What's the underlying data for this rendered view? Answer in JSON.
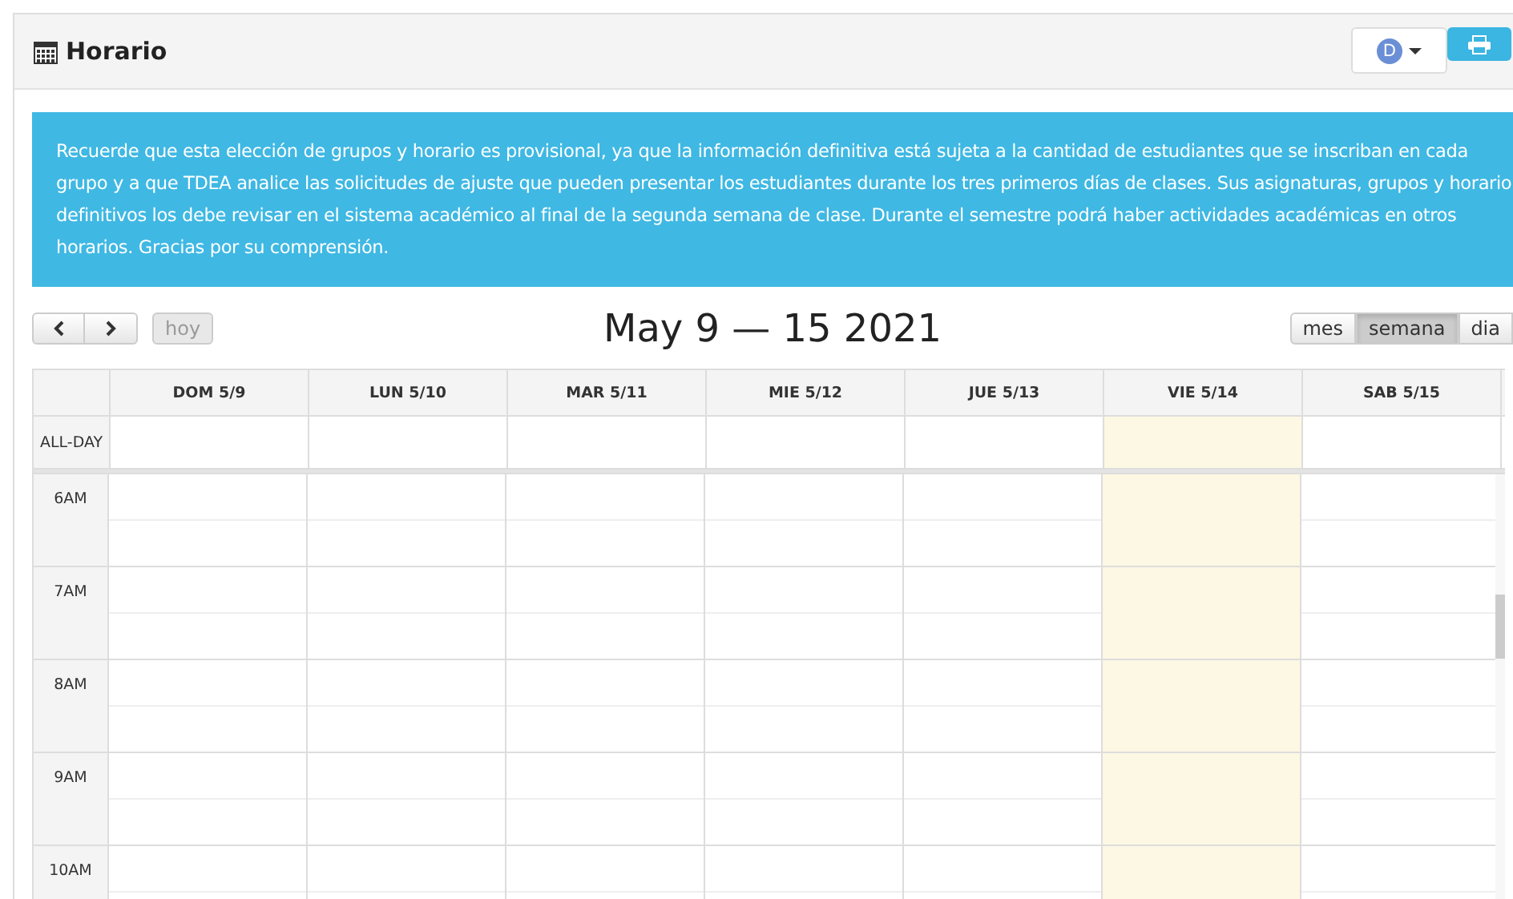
{
  "header": {
    "title": "Horario",
    "avatar_letter": "D"
  },
  "notice": "Recuerde que esta elección de grupos y horario es provisional, ya que la información definitiva está sujeta a la cantidad de estudiantes que se inscriban en cada grupo y a que TDEA analice las solicitudes de ajuste que pueden presentar los estudiantes durante los tres primeros días de clases. Sus asignaturas, grupos y horario definitivos los debe revisar en el sistema académico al final de la segunda semana de clase. Durante el semestre podrá haber actividades académicas en otros horarios. Gracias por su comprensión.",
  "toolbar": {
    "today_button": "hoy",
    "range_title": "May 9 — 15 2021",
    "views": [
      {
        "label": "mes",
        "selected": false
      },
      {
        "label": "semana",
        "selected": true
      },
      {
        "label": "dia",
        "selected": false
      }
    ]
  },
  "calendar": {
    "all_day_label": "ALL-DAY",
    "days": [
      {
        "label": "DOM 5/9",
        "today": false
      },
      {
        "label": "LUN 5/10",
        "today": false
      },
      {
        "label": "MAR 5/11",
        "today": false
      },
      {
        "label": "MIE 5/12",
        "today": false
      },
      {
        "label": "JUE 5/13",
        "today": false
      },
      {
        "label": "VIE 5/14",
        "today": true
      },
      {
        "label": "SAB 5/15",
        "today": false
      }
    ],
    "hours": [
      "6AM",
      "7AM",
      "8AM",
      "9AM",
      "10AM"
    ]
  }
}
